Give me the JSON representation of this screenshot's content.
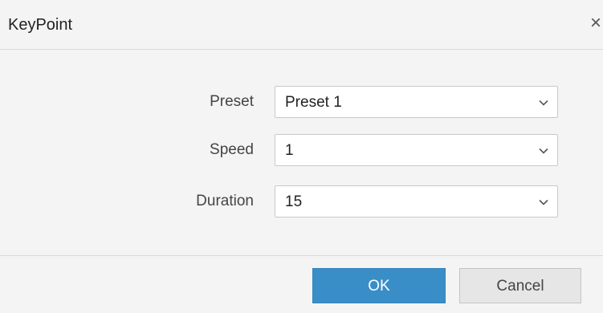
{
  "dialog": {
    "title": "KeyPoint",
    "close_glyph": "×",
    "fields": [
      {
        "label": "Preset",
        "value": "Preset 1"
      },
      {
        "label": "Speed",
        "value": "1"
      },
      {
        "label": "Duration",
        "value": "15"
      }
    ],
    "buttons": {
      "ok_label": "OK",
      "cancel_label": "Cancel"
    }
  },
  "colors": {
    "primary": "#3a8ec8",
    "background": "#f4f4f4",
    "secondary_button": "#e6e6e6"
  },
  "icons": {
    "close": "close-icon",
    "dropdown": "chevron-down-icon"
  }
}
